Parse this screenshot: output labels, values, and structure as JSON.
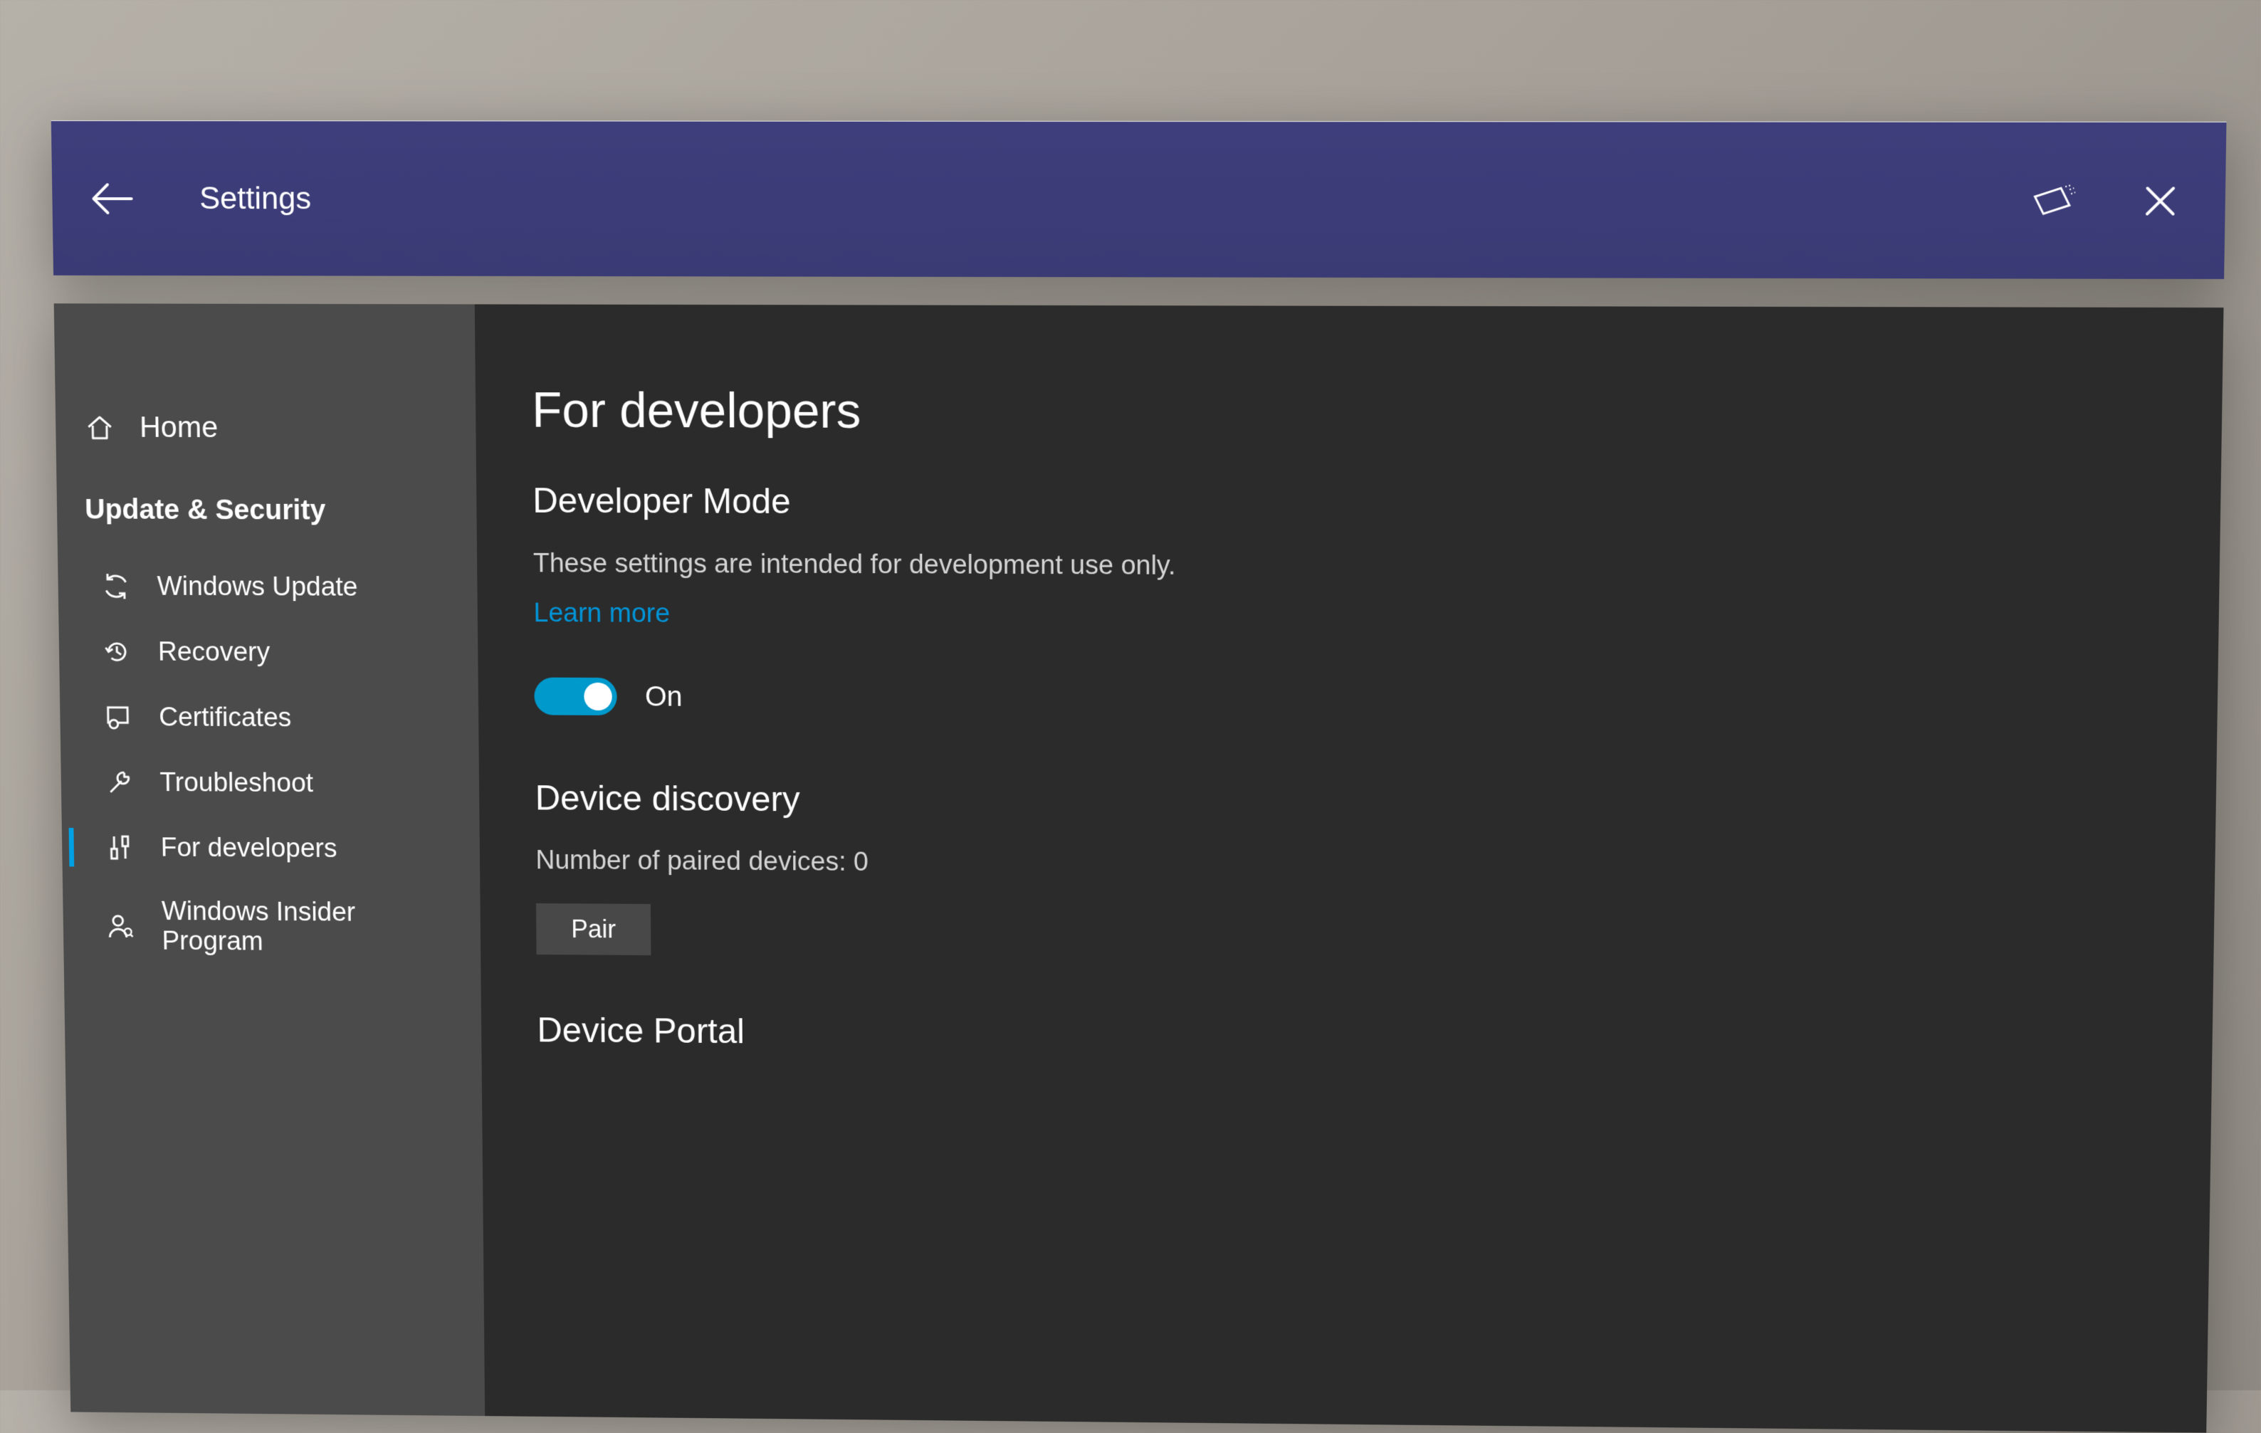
{
  "titlebar": {
    "title": "Settings"
  },
  "sidebar": {
    "home_label": "Home",
    "section_title": "Update & Security",
    "items": [
      {
        "label": "Windows Update"
      },
      {
        "label": "Recovery"
      },
      {
        "label": "Certificates"
      },
      {
        "label": "Troubleshoot"
      },
      {
        "label": "For developers"
      },
      {
        "label": "Windows Insider Program"
      }
    ]
  },
  "main": {
    "page_title": "For developers",
    "dev_mode": {
      "heading": "Developer Mode",
      "description": "These settings are intended for development use only.",
      "learn_more": "Learn more",
      "toggle_state": "On"
    },
    "device_discovery": {
      "heading": "Device discovery",
      "paired_text": "Number of paired devices: 0",
      "pair_button": "Pair"
    },
    "device_portal": {
      "heading": "Device Portal"
    }
  }
}
